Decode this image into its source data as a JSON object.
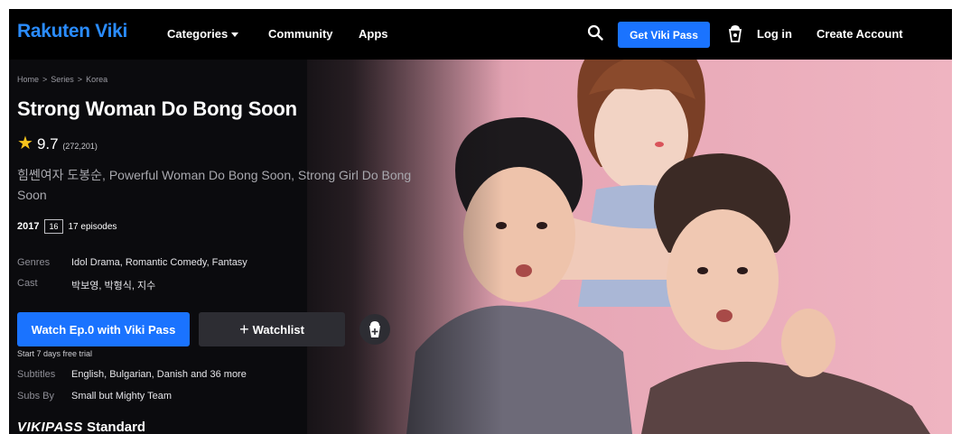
{
  "nav": {
    "logo": "Rakuten Viki",
    "links": [
      "Categories",
      "Community",
      "Apps"
    ],
    "get_pass_label": "Get Viki Pass",
    "login_label": "Log in",
    "create_account_label": "Create Account"
  },
  "breadcrumb": [
    "Home",
    "Series",
    "Korea"
  ],
  "breadcrumb_separator": ">",
  "show": {
    "title": "Strong Woman Do Bong Soon",
    "rating": "9.7",
    "rating_count": "(272,201)",
    "alt_titles": "힘쎈여자 도봉순, Powerful Woman Do Bong Soon, Strong Girl Do Bong Soon",
    "year": "2017",
    "age_rating": "16",
    "episodes": "17 episodes",
    "genres_label": "Genres",
    "genres": "Idol Drama, Romantic Comedy, Fantasy",
    "cast_label": "Cast",
    "cast": "박보영, 박형식, 지수",
    "subtitles_label": "Subtitles",
    "subtitles": "English, Bulgarian, Danish and 36 more",
    "subs_by_label": "Subs By",
    "subs_by": "Small but Mighty Team"
  },
  "actions": {
    "watch_label": "Watch Ep.0 with Viki Pass",
    "watchlist_label": "Watchlist",
    "trial_note": "Start 7 days free trial"
  },
  "plan": {
    "brand": "VIKIPASS",
    "tier": "Standard"
  },
  "colors": {
    "accent": "#1a73ff",
    "logo": "#2a8cff",
    "star": "#f7c31c",
    "hero_bg": "#efb4c1"
  }
}
